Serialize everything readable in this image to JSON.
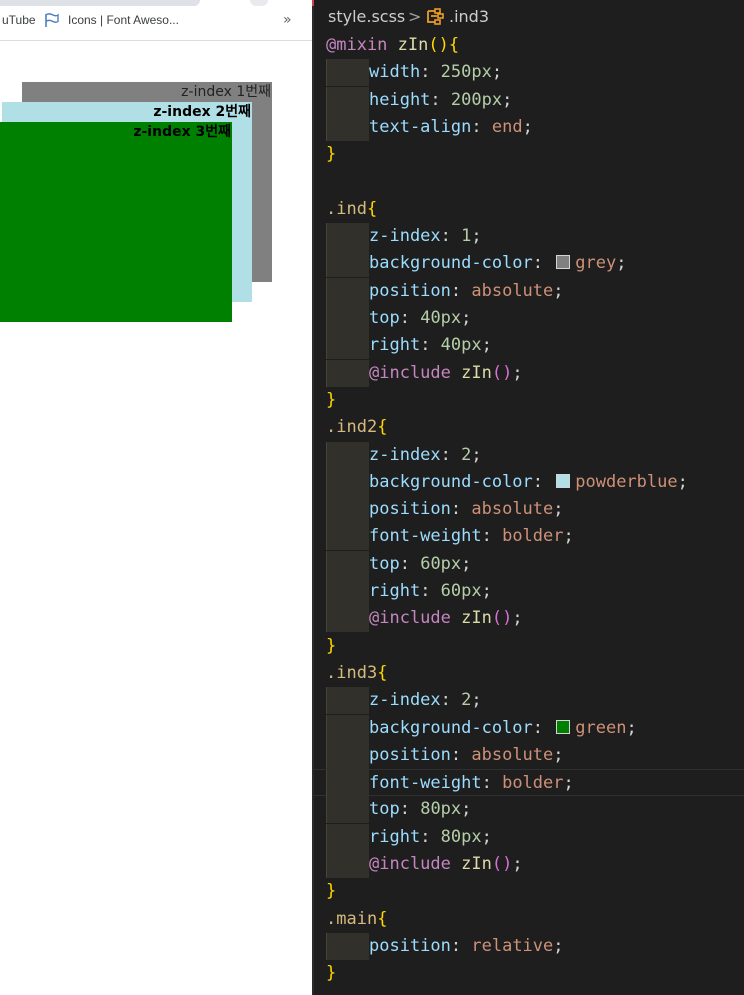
{
  "browser": {
    "bookmarks": [
      {
        "label": "uTube"
      },
      {
        "label": "Icons | Font Aweso..."
      }
    ],
    "more_label": "»",
    "boxes": [
      {
        "label": "z-index 1번째",
        "color": "#808080"
      },
      {
        "label": "z-index 2번째",
        "color": "#b0e0e6"
      },
      {
        "label": "z-index 3번째",
        "color": "#008000"
      }
    ]
  },
  "editor": {
    "breadcrumb": {
      "file": "style.scss",
      "separator": ">",
      "symbol_icon": "selector-symbol-icon",
      "symbol": ".ind3"
    },
    "lines": [
      {
        "tokens": [
          [
            "kw",
            "@mixin"
          ],
          [
            "pun",
            " "
          ],
          [
            "fn",
            "zIn"
          ],
          [
            "br",
            "()"
          ],
          [
            "br",
            "{"
          ]
        ]
      },
      {
        "indent": true,
        "tokens": [
          [
            "prop",
            "width"
          ],
          [
            "pun",
            ": "
          ],
          [
            "num",
            "250px"
          ],
          [
            "pun",
            ";"
          ]
        ]
      },
      {
        "indent": true,
        "tokens": [
          [
            "prop",
            "height"
          ],
          [
            "pun",
            ": "
          ],
          [
            "num",
            "200px"
          ],
          [
            "pun",
            ";"
          ]
        ]
      },
      {
        "indent": true,
        "tokens": [
          [
            "prop",
            "text-align"
          ],
          [
            "pun",
            ": "
          ],
          [
            "val",
            "end"
          ],
          [
            "pun",
            ";"
          ]
        ]
      },
      {
        "tokens": [
          [
            "br",
            "}"
          ]
        ]
      },
      {
        "tokens": []
      },
      {
        "tokens": [
          [
            "sel",
            ".ind"
          ],
          [
            "br",
            "{"
          ]
        ]
      },
      {
        "indent": true,
        "tokens": [
          [
            "prop",
            "z-index"
          ],
          [
            "pun",
            ": "
          ],
          [
            "num",
            "1"
          ],
          [
            "pun",
            ";"
          ]
        ]
      },
      {
        "indent": true,
        "tokens": [
          [
            "prop",
            "background-color"
          ],
          [
            "pun",
            ": "
          ],
          [
            "swatch",
            "#808080"
          ],
          [
            "val",
            "grey"
          ],
          [
            "pun",
            ";"
          ]
        ]
      },
      {
        "indent": true,
        "tokens": [
          [
            "prop",
            "position"
          ],
          [
            "pun",
            ": "
          ],
          [
            "val",
            "absolute"
          ],
          [
            "pun",
            ";"
          ]
        ]
      },
      {
        "indent": true,
        "tokens": [
          [
            "prop",
            "top"
          ],
          [
            "pun",
            ": "
          ],
          [
            "num",
            "40px"
          ],
          [
            "pun",
            ";"
          ]
        ]
      },
      {
        "indent": true,
        "tokens": [
          [
            "prop",
            "right"
          ],
          [
            "pun",
            ": "
          ],
          [
            "num",
            "40px"
          ],
          [
            "pun",
            ";"
          ]
        ]
      },
      {
        "indent": true,
        "tokens": [
          [
            "kw",
            "@include"
          ],
          [
            "pun",
            " "
          ],
          [
            "fn",
            "zIn"
          ],
          [
            "par",
            "()"
          ],
          [
            "pun",
            ";"
          ]
        ]
      },
      {
        "tokens": [
          [
            "br",
            "}"
          ]
        ]
      },
      {
        "tokens": [
          [
            "sel",
            ".ind2"
          ],
          [
            "br",
            "{"
          ]
        ]
      },
      {
        "indent": true,
        "tokens": [
          [
            "prop",
            "z-index"
          ],
          [
            "pun",
            ": "
          ],
          [
            "num",
            "2"
          ],
          [
            "pun",
            ";"
          ]
        ]
      },
      {
        "indent": true,
        "tokens": [
          [
            "prop",
            "background-color"
          ],
          [
            "pun",
            ": "
          ],
          [
            "swatch",
            "#b0e0e6"
          ],
          [
            "val",
            "powderblue"
          ],
          [
            "pun",
            ";"
          ]
        ]
      },
      {
        "indent": true,
        "tokens": [
          [
            "prop",
            "position"
          ],
          [
            "pun",
            ": "
          ],
          [
            "val",
            "absolute"
          ],
          [
            "pun",
            ";"
          ]
        ]
      },
      {
        "indent": true,
        "tokens": [
          [
            "prop",
            "font-weight"
          ],
          [
            "pun",
            ": "
          ],
          [
            "val",
            "bolder"
          ],
          [
            "pun",
            ";"
          ]
        ]
      },
      {
        "indent": true,
        "tokens": [
          [
            "prop",
            "top"
          ],
          [
            "pun",
            ": "
          ],
          [
            "num",
            "60px"
          ],
          [
            "pun",
            ";"
          ]
        ]
      },
      {
        "indent": true,
        "tokens": [
          [
            "prop",
            "right"
          ],
          [
            "pun",
            ": "
          ],
          [
            "num",
            "60px"
          ],
          [
            "pun",
            ";"
          ]
        ]
      },
      {
        "indent": true,
        "tokens": [
          [
            "kw",
            "@include"
          ],
          [
            "pun",
            " "
          ],
          [
            "fn",
            "zIn"
          ],
          [
            "par",
            "()"
          ],
          [
            "pun",
            ";"
          ]
        ]
      },
      {
        "tokens": [
          [
            "br",
            "}"
          ]
        ]
      },
      {
        "tokens": [
          [
            "sel",
            ".ind3"
          ],
          [
            "br",
            "{"
          ]
        ]
      },
      {
        "indent": true,
        "tokens": [
          [
            "prop",
            "z-index"
          ],
          [
            "pun",
            ": "
          ],
          [
            "num",
            "2"
          ],
          [
            "pun",
            ";"
          ]
        ]
      },
      {
        "indent": true,
        "tokens": [
          [
            "prop",
            "background-color"
          ],
          [
            "pun",
            ": "
          ],
          [
            "swatch",
            "#008000"
          ],
          [
            "val",
            "green"
          ],
          [
            "pun",
            ";"
          ]
        ]
      },
      {
        "indent": true,
        "tokens": [
          [
            "prop",
            "position"
          ],
          [
            "pun",
            ": "
          ],
          [
            "val",
            "absolute"
          ],
          [
            "pun",
            ";"
          ]
        ]
      },
      {
        "indent": true,
        "current": true,
        "tokens": [
          [
            "prop",
            "font-weight"
          ],
          [
            "pun",
            ": "
          ],
          [
            "val",
            "bolder"
          ],
          [
            "pun",
            ";"
          ]
        ]
      },
      {
        "indent": true,
        "tokens": [
          [
            "prop",
            "top"
          ],
          [
            "pun",
            ": "
          ],
          [
            "num",
            "80px"
          ],
          [
            "pun",
            ";"
          ]
        ]
      },
      {
        "indent": true,
        "tokens": [
          [
            "prop",
            "right"
          ],
          [
            "pun",
            ": "
          ],
          [
            "num",
            "80px"
          ],
          [
            "pun",
            ";"
          ]
        ]
      },
      {
        "indent": true,
        "tokens": [
          [
            "kw",
            "@include"
          ],
          [
            "pun",
            " "
          ],
          [
            "fn",
            "zIn"
          ],
          [
            "par",
            "()"
          ],
          [
            "pun",
            ";"
          ]
        ]
      },
      {
        "tokens": [
          [
            "br",
            "}"
          ]
        ]
      },
      {
        "tokens": [
          [
            "sel",
            ".main"
          ],
          [
            "br",
            "{"
          ]
        ]
      },
      {
        "indent": true,
        "tokens": [
          [
            "prop",
            "position"
          ],
          [
            "pun",
            ": "
          ],
          [
            "val",
            "relative"
          ],
          [
            "pun",
            ";"
          ]
        ]
      },
      {
        "tokens": [
          [
            "br",
            "}"
          ]
        ]
      }
    ]
  }
}
